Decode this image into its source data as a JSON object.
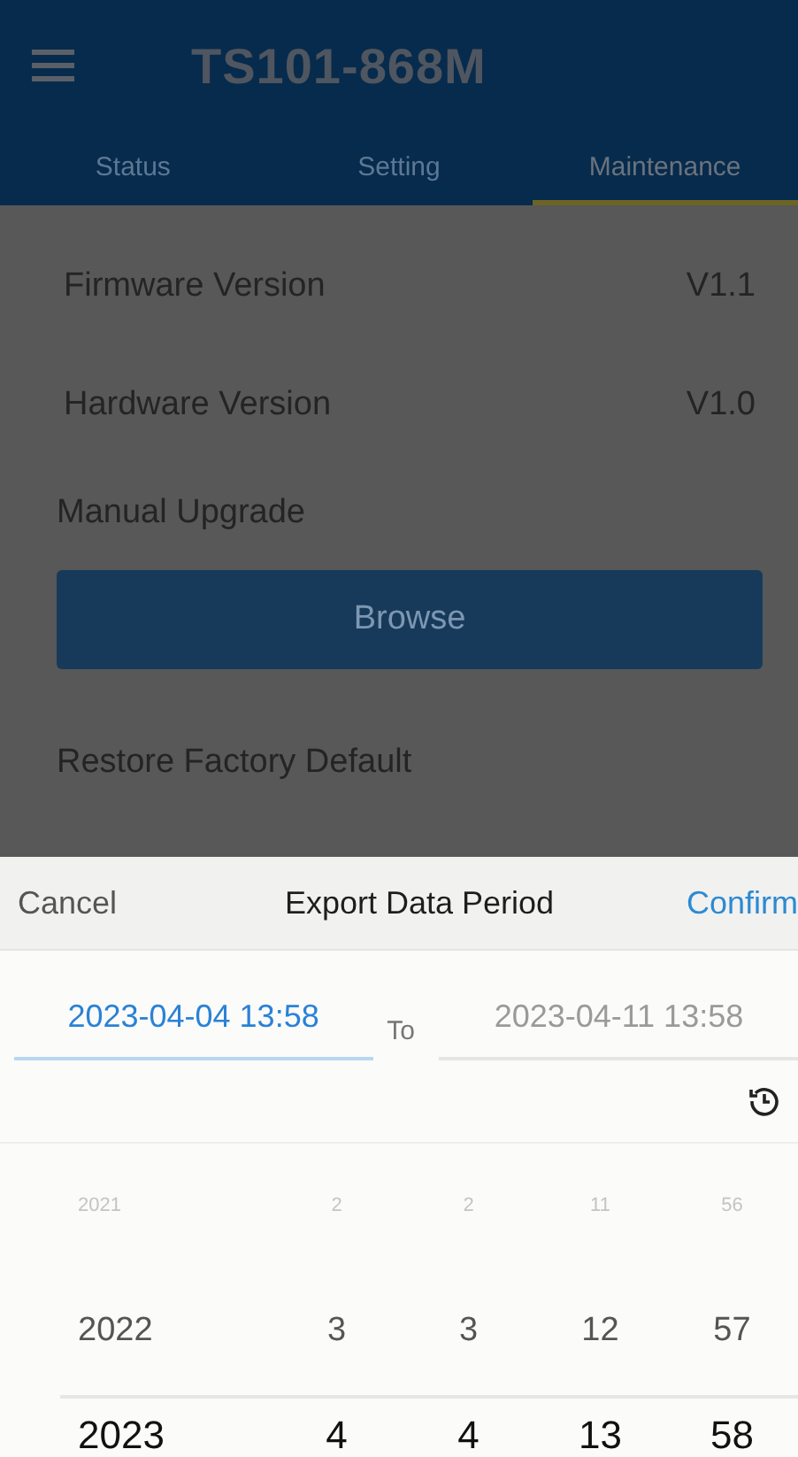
{
  "app_bar": {
    "title": "TS101-868M"
  },
  "tabs": [
    {
      "label": "Status",
      "selected": false
    },
    {
      "label": "Setting",
      "selected": false
    },
    {
      "label": "Maintenance",
      "selected": true
    }
  ],
  "info_rows": [
    {
      "label": "Firmware Version",
      "value": "V1.1"
    },
    {
      "label": "Hardware Version",
      "value": "V1.0"
    }
  ],
  "manual_upgrade": {
    "label": "Manual Upgrade",
    "button": "Browse"
  },
  "restore": {
    "label": "Restore Factory Default"
  },
  "sheet": {
    "cancel": "Cancel",
    "title": "Export Data Period",
    "confirm": "Confirm",
    "start": {
      "value": "2023-04-04 13:58",
      "selected": true
    },
    "separator": "To",
    "end": {
      "value": "2023-04-11 13:58",
      "selected": false
    },
    "picker_rows": [
      {
        "kind": "far",
        "selected": false,
        "values": [
          "2021",
          "2",
          "2",
          "11",
          "56"
        ]
      },
      {
        "kind": "near",
        "selected": false,
        "values": [
          "2022",
          "3",
          "3",
          "12",
          "57"
        ]
      },
      {
        "kind": "center",
        "selected": true,
        "values": [
          "2023",
          "4",
          "4",
          "13",
          "58"
        ]
      }
    ]
  }
}
